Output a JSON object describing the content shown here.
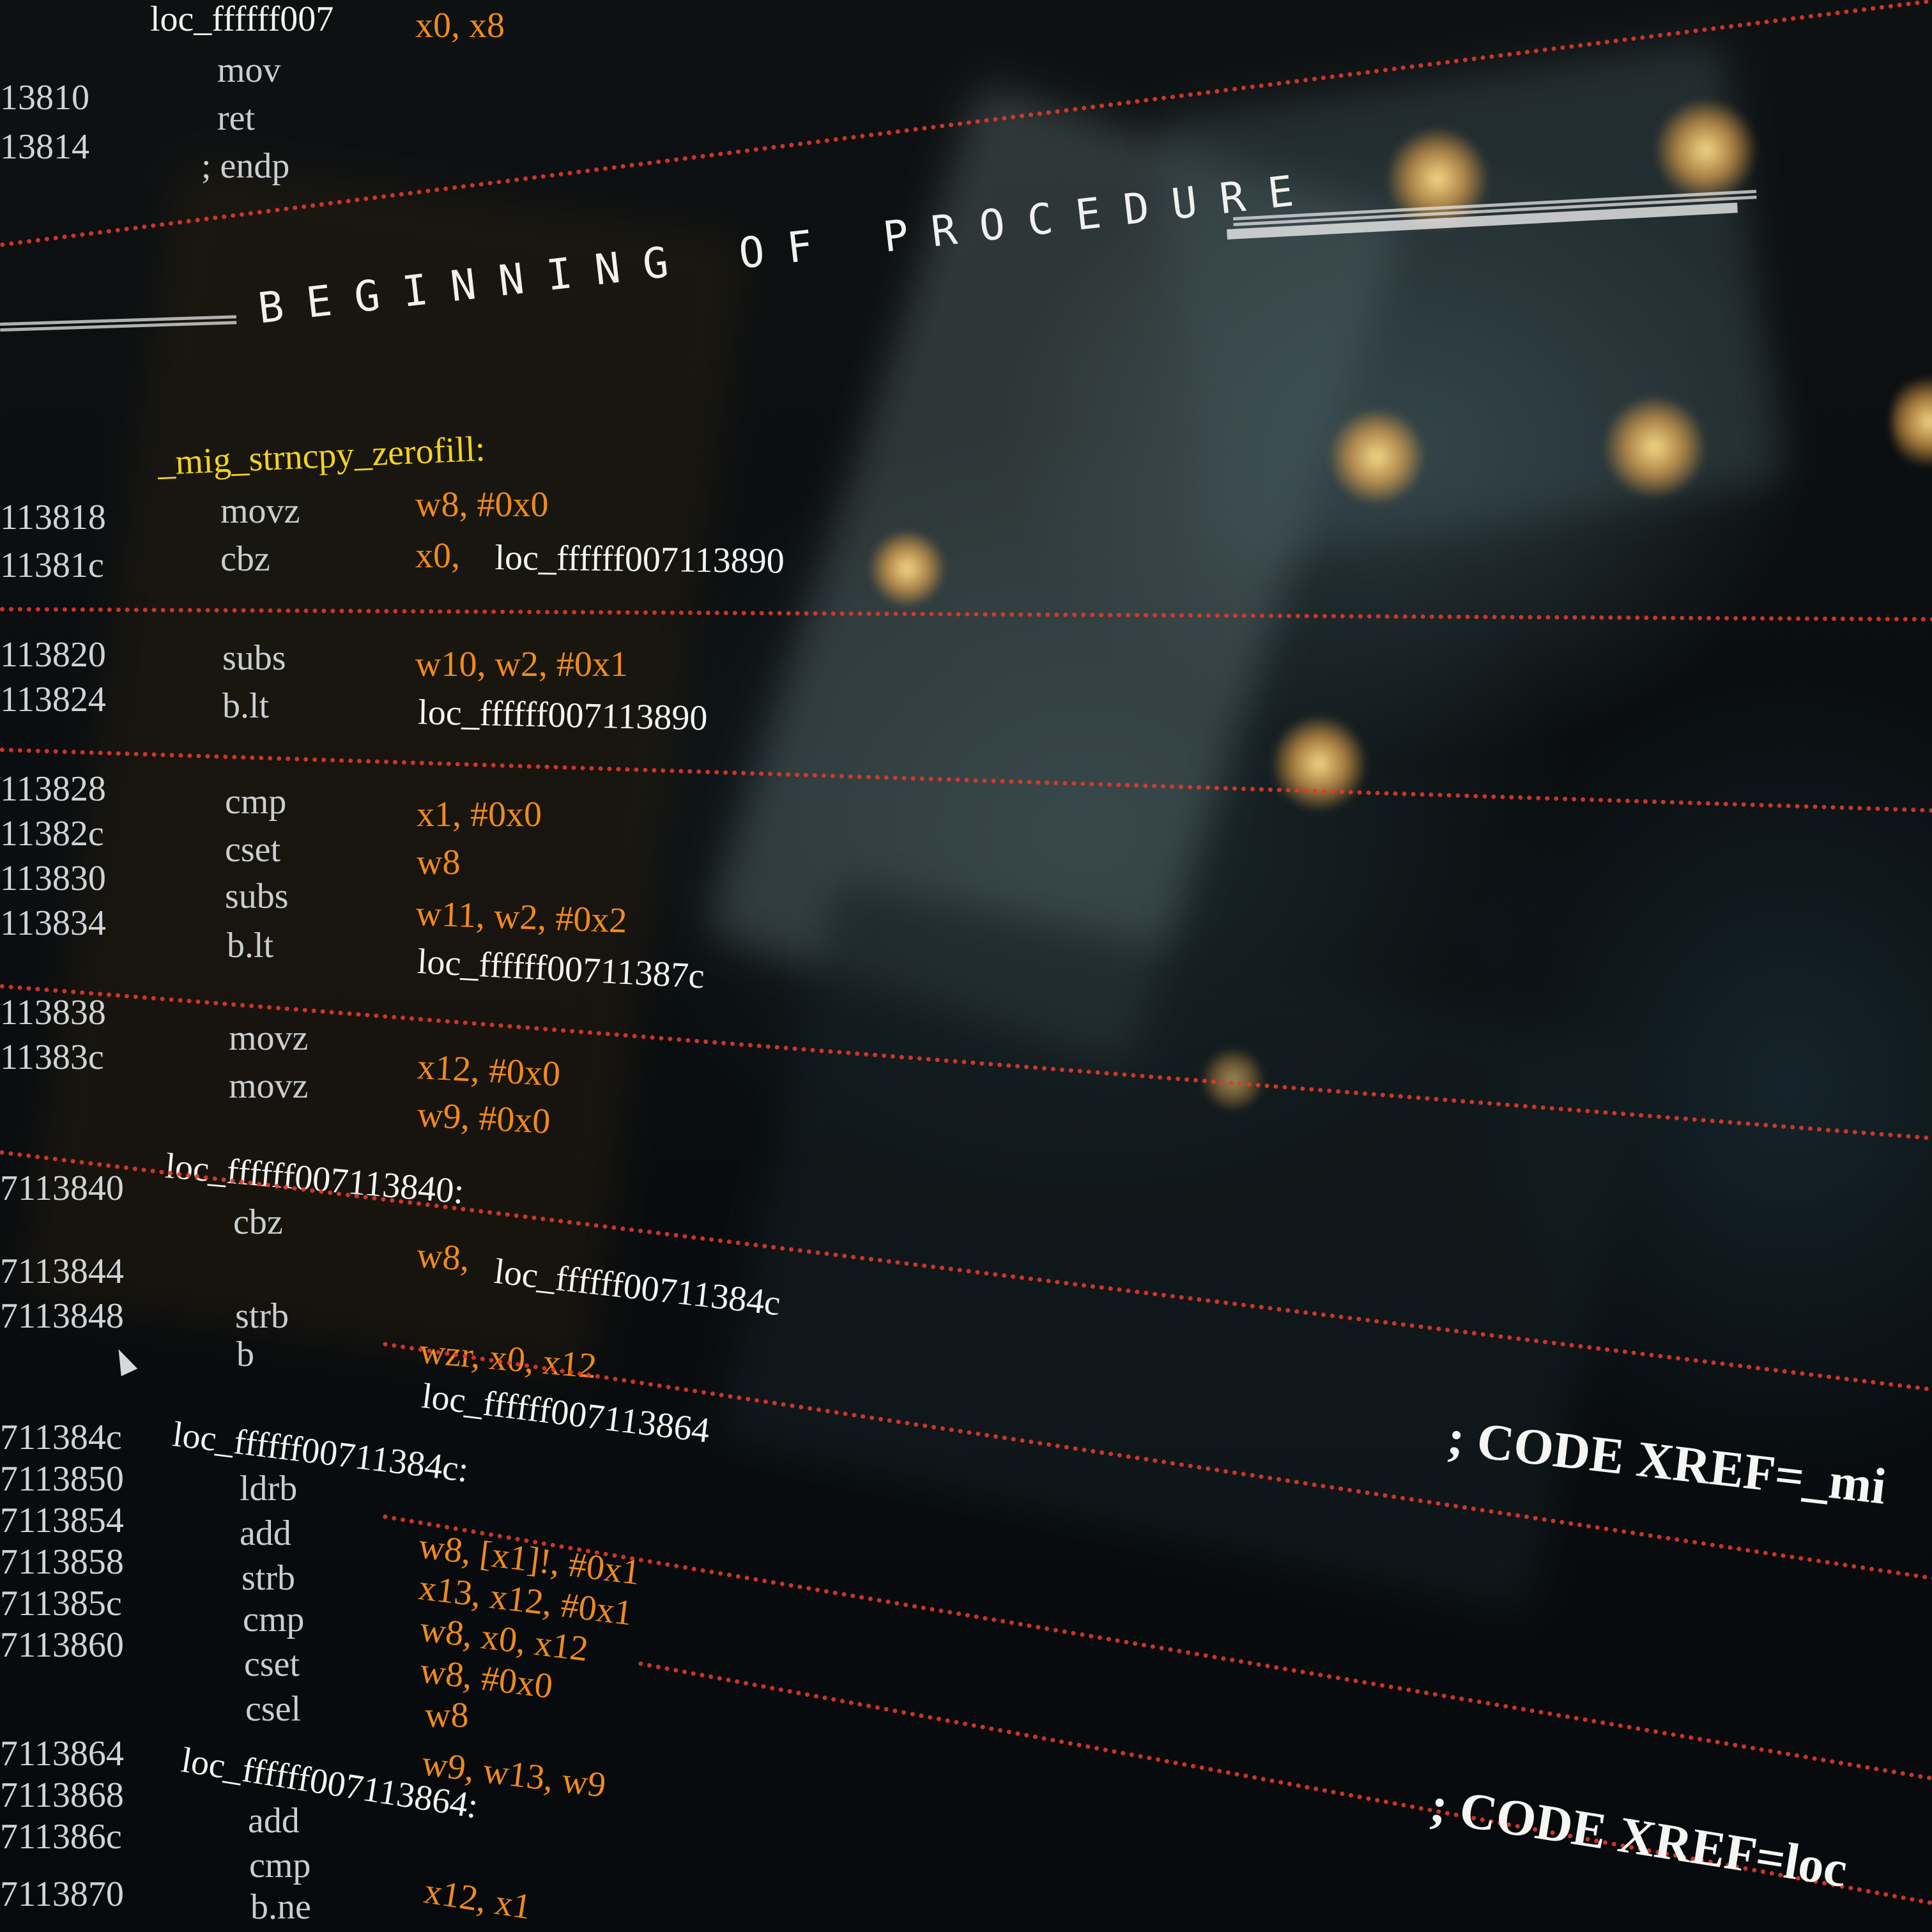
{
  "header": {
    "label": "loc_ffffff007",
    "top_operands": "x0, x8"
  },
  "lines": [
    {
      "addr": "13810",
      "mnem": "mov",
      "ops": "",
      "ops_class": "op-orange"
    },
    {
      "addr": "13814",
      "mnem": "ret",
      "ops": "",
      "ops_class": "op-orange"
    },
    {
      "addr": "",
      "mnem": "; endp",
      "ops": "",
      "ops_class": "op-orange"
    }
  ],
  "banner": {
    "text": "BEGINNING OF PROCEDURE"
  },
  "procedure": {
    "name": "_mig_strncpy_zerofill:"
  },
  "code": [
    {
      "addr": "113818",
      "mnem": "movz",
      "ops": "w8, #0x0",
      "cls": "op-orange"
    },
    {
      "addr": "11381c",
      "mnem": "cbz",
      "ops": "x0, ",
      "ops2": "loc_ffffff007113890",
      "cls": "op-orange"
    },
    {
      "addr": "113820",
      "mnem": "subs",
      "ops": "w10, w2, #0x1",
      "cls": "op-orange"
    },
    {
      "addr": "113824",
      "mnem": "b.lt",
      "ops": "",
      "ops2": "loc_ffffff007113890",
      "cls": "op-orange"
    },
    {
      "addr": "113828",
      "mnem": "cmp",
      "ops": "x1, #0x0",
      "cls": "op-orange"
    },
    {
      "addr": "11382c",
      "mnem": "cset",
      "ops": "w8",
      "cls": "op-orange"
    },
    {
      "addr": "113830",
      "mnem": "subs",
      "ops": "w11, w2, #0x2",
      "cls": "op-orange"
    },
    {
      "addr": "113834",
      "mnem": "b.lt",
      "ops": "",
      "ops2": "loc_ffffff00711387c",
      "cls": "op-orange"
    },
    {
      "addr": "113838",
      "mnem": "movz",
      "ops": "x12, #0x0",
      "cls": "op-orange"
    },
    {
      "addr": "11383c",
      "mnem": "movz",
      "ops": "w9, #0x0",
      "cls": "op-orange"
    }
  ],
  "block1": {
    "label": "loc_ffffff007113840:",
    "addr": "7113840",
    "lines": [
      {
        "addr": "7113844",
        "mnem": "cbz",
        "ops": "w8, ",
        "ops2": "loc_ffffff00711384c"
      },
      {
        "addr": "7113848",
        "mnem": "strb",
        "ops": "wzr, x0, x12",
        "ops2": ""
      },
      {
        "addr": "",
        "mnem": "b",
        "ops": "",
        "ops2": "loc_ffffff007113864"
      }
    ]
  },
  "block2": {
    "label": "loc_ffffff00711384c:",
    "lines": [
      {
        "addr": "711384c",
        "mnem": "ldrb",
        "ops": "w8, [x1]!, #0x1"
      },
      {
        "addr": "7113850",
        "mnem": "add",
        "ops": "x13, x12, #0x1"
      },
      {
        "addr": "7113854",
        "mnem": "strb",
        "ops": "w8, x0, x12"
      },
      {
        "addr": "7113858",
        "mnem": "cmp",
        "ops": "w8, #0x0"
      },
      {
        "addr": "711385c",
        "mnem": "cset",
        "ops": "w8"
      },
      {
        "addr": "7113860",
        "mnem": "csel",
        "ops": "w9, w13, w9"
      }
    ]
  },
  "block3": {
    "label": "loc_ffffff007113864:",
    "lines": [
      {
        "addr": "7113864",
        "mnem": "add",
        "ops": "x12, x1"
      },
      {
        "addr": "7113868",
        "mnem": "cmp",
        "ops": ""
      },
      {
        "addr": "711386c",
        "mnem": "b.ne",
        "ops": ""
      },
      {
        "addr": "7113870",
        "mnem": "",
        "ops": ""
      }
    ]
  },
  "comments": {
    "xref1": "; CODE XREF=_mi",
    "xref2": "; CODE XREF=loc"
  },
  "colors": {
    "operand": "#f08a1c",
    "label_proc": "#f4d21e",
    "separator": "#e2392b",
    "text": "#f3f3f1"
  }
}
